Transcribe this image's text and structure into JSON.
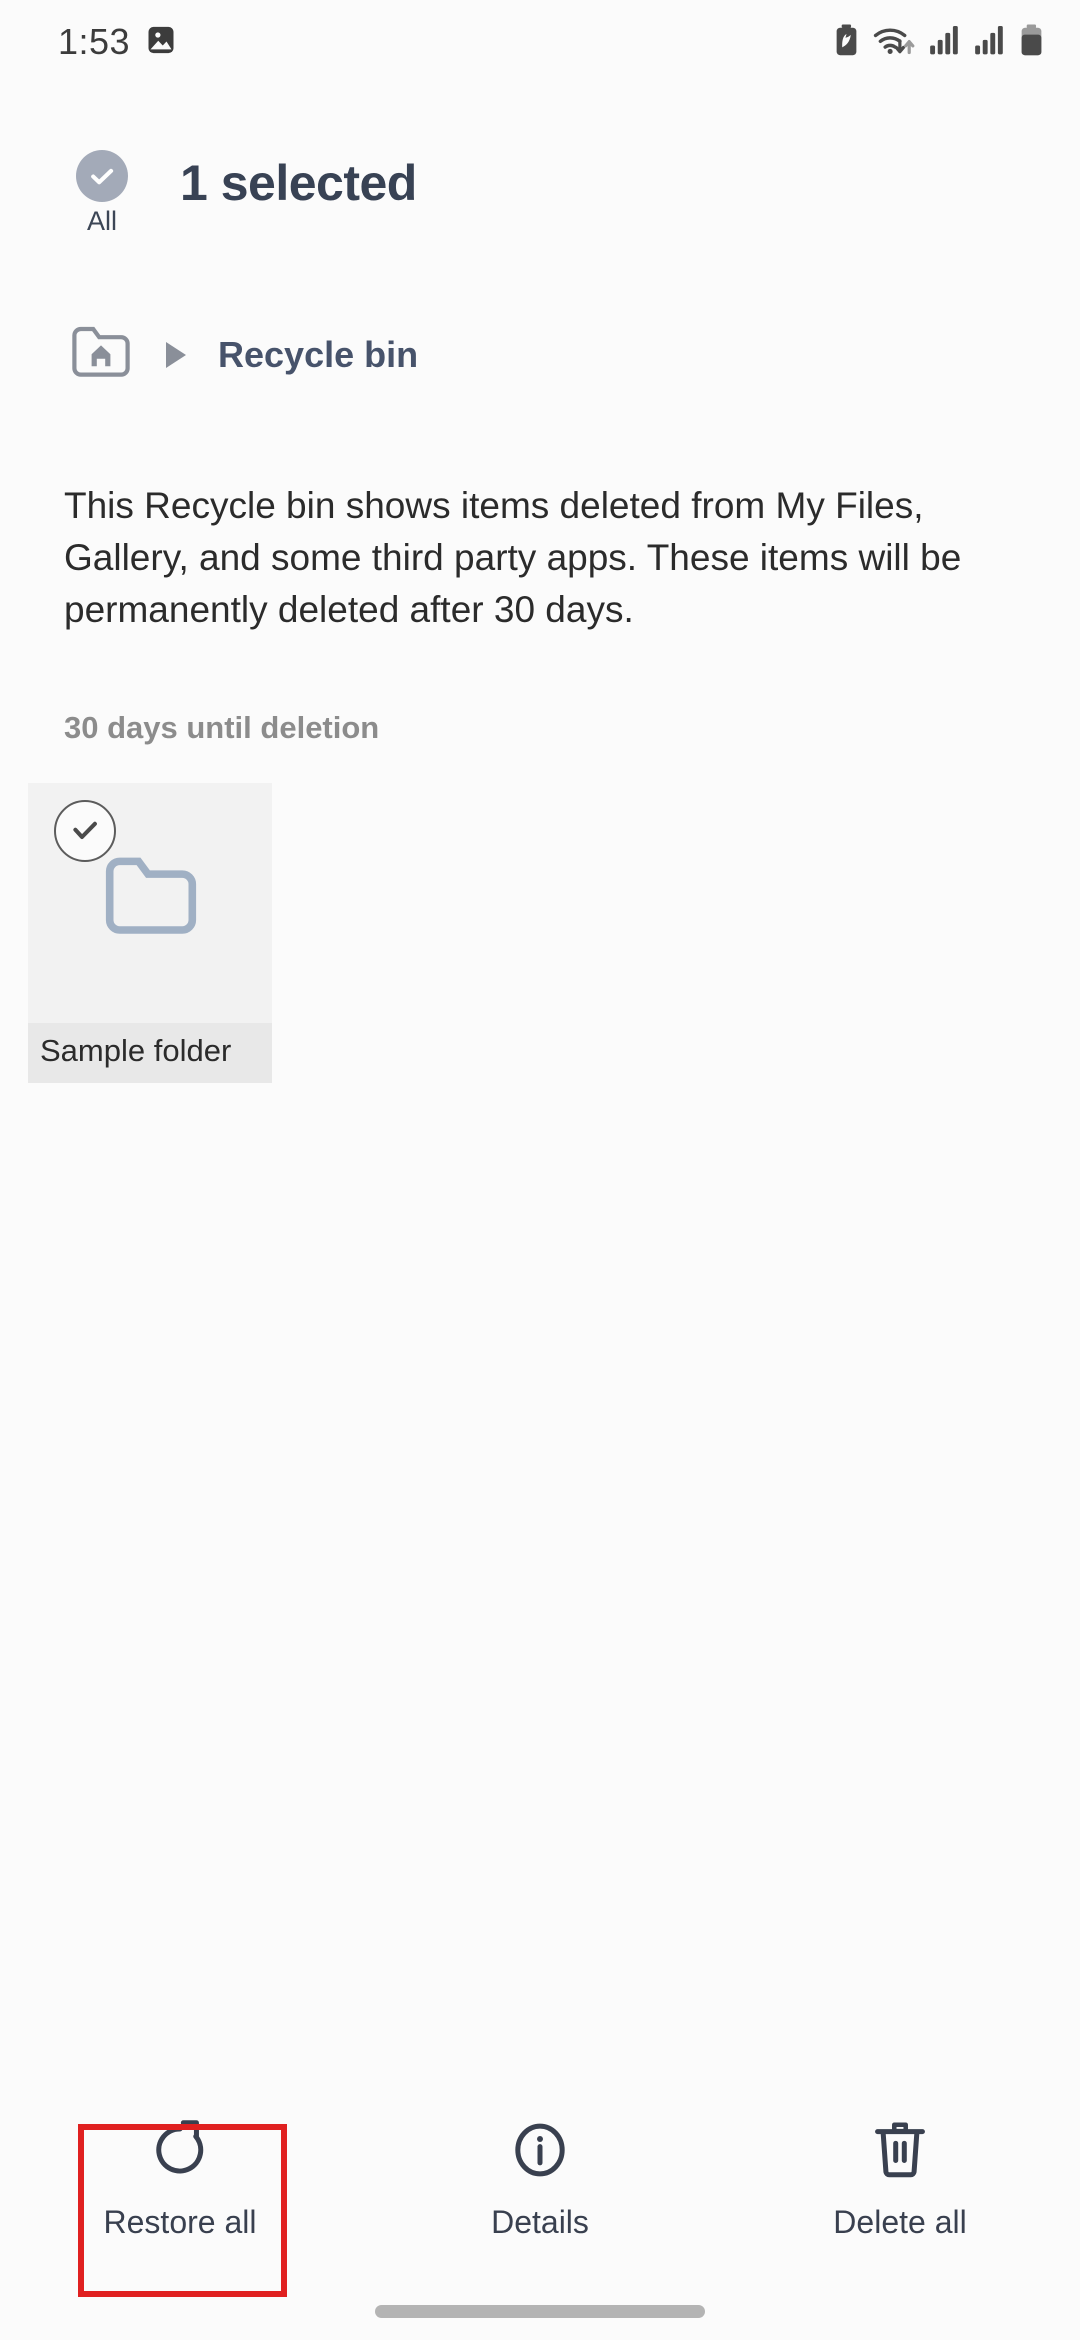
{
  "status_bar": {
    "time": "1:53",
    "left_icons": [
      "gallery-image-icon"
    ],
    "right_icons": [
      "battery-saver-icon",
      "wifi-transfer-icon",
      "signal-bars-icon-1",
      "signal-bars-icon-2",
      "battery-icon"
    ]
  },
  "selection_header": {
    "all_label": "All",
    "all_checked": true,
    "title": "1 selected"
  },
  "breadcrumb": {
    "home_icon": "home-folder-icon",
    "separator_icon": "triangle-right-icon",
    "current": "Recycle bin"
  },
  "description": "This Recycle bin shows items deleted from My Files, Gallery, and some third party apps. These items will be permanently deleted after 30 days.",
  "section": {
    "header": "30 days until deletion"
  },
  "items": [
    {
      "name": "Sample folder",
      "icon": "folder-icon",
      "selected": true
    }
  ],
  "bottom_bar": {
    "buttons": [
      {
        "label": "Restore all",
        "icon": "restore-icon",
        "highlighted": true
      },
      {
        "label": "Details",
        "icon": "info-circle-icon",
        "highlighted": false
      },
      {
        "label": "Delete all",
        "icon": "trash-icon",
        "highlighted": false
      }
    ]
  },
  "colors": {
    "background": "#fbfbfb",
    "title_text": "#384254",
    "breadcrumb_text": "#47536b",
    "section_header": "#8c8c8c",
    "tile_background": "#f2f2f2",
    "tile_label_background": "#e8e8e8",
    "folder_icon": "#a0b0c4",
    "highlight_border": "#e02020",
    "bottom_icon": "#39404f"
  }
}
